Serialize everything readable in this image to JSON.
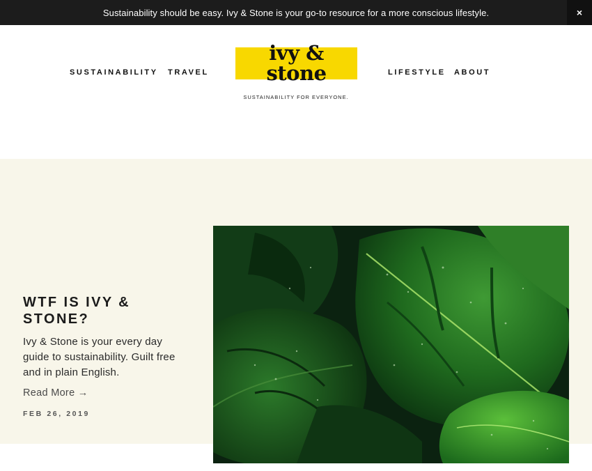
{
  "announcement": {
    "text": "Sustainability should be easy. Ivy & Stone is your go-to resource for a more conscious lifestyle.",
    "close_glyph": "×"
  },
  "nav": {
    "left": [
      {
        "label": "SUSTAINABILITY"
      },
      {
        "label": "TRAVEL"
      }
    ],
    "right": [
      {
        "label": "LIFESTYLE"
      },
      {
        "label": "ABOUT"
      }
    ]
  },
  "logo": {
    "line1": "ivy &",
    "line2": "stone",
    "tagline": "SUSTAINABILITY FOR EVERYONE.",
    "highlight_color": "#f8d800"
  },
  "featured_post": {
    "title": "WTF IS IVY & STONE?",
    "excerpt": "Ivy & Stone is your every day guide to sustainability. Guilt free and in plain English.",
    "read_more": "Read More →",
    "date": "FEB 26, 2019",
    "image_icon": "monstera-leaves-photo"
  },
  "colors": {
    "announcement_bg": "#1c1c1c",
    "hero_bg": "#f8f6ea",
    "accent_yellow": "#f8d800"
  }
}
